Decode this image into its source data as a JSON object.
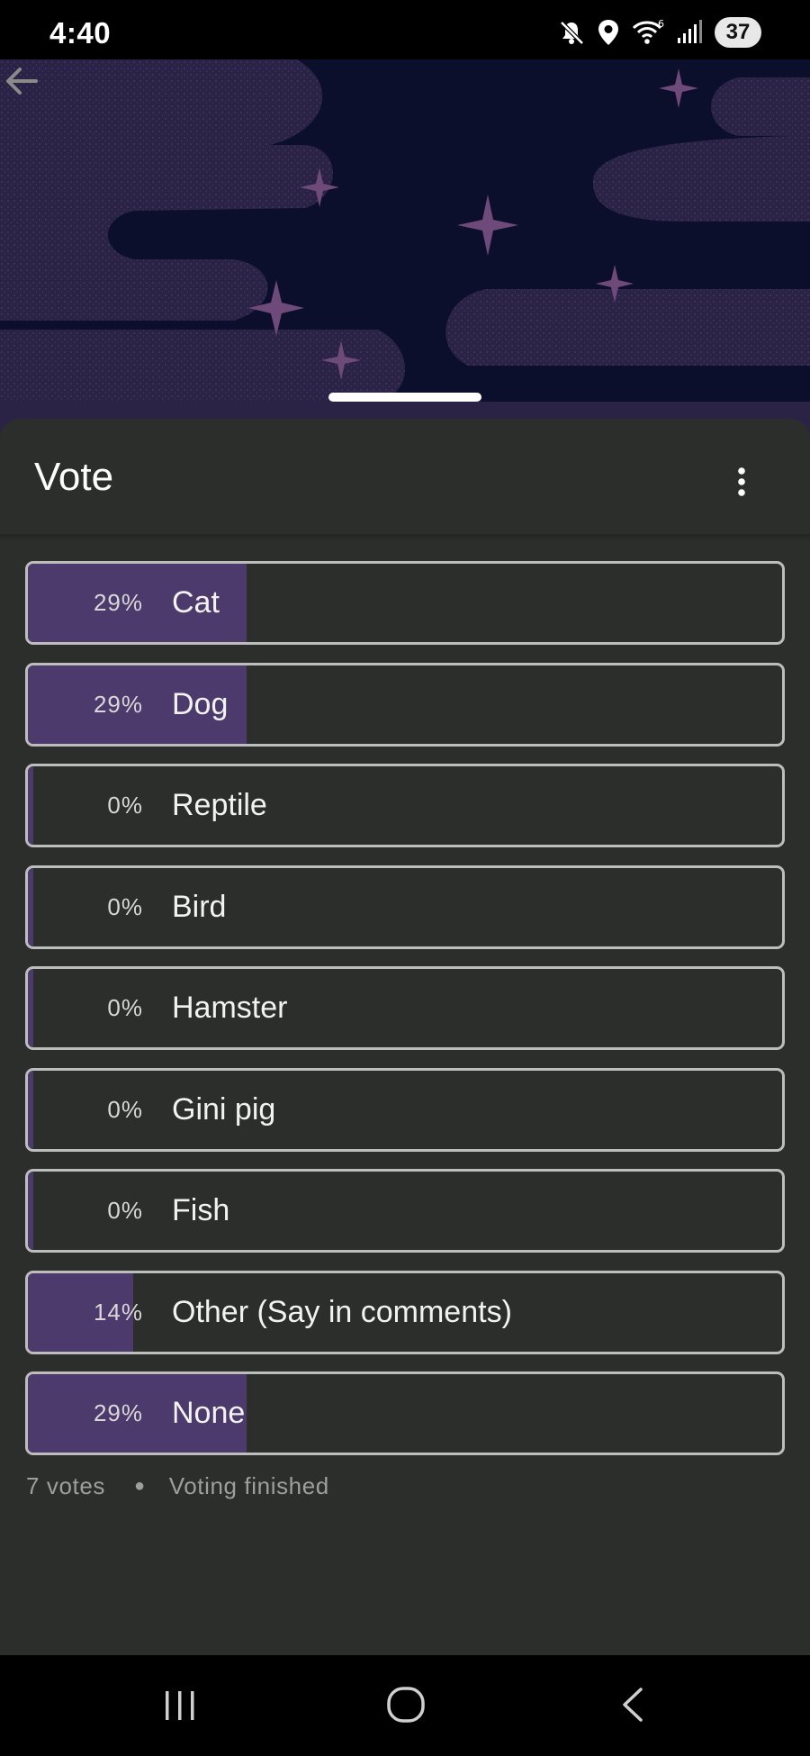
{
  "status_bar": {
    "time": "4:40",
    "battery": "37",
    "network": "6"
  },
  "poll": {
    "title": "Vote",
    "options": [
      {
        "percent": "29%",
        "label": "Cat",
        "value": 29
      },
      {
        "percent": "29%",
        "label": "Dog",
        "value": 29
      },
      {
        "percent": "0%",
        "label": "Reptile",
        "value": 0
      },
      {
        "percent": "0%",
        "label": "Bird",
        "value": 0
      },
      {
        "percent": "0%",
        "label": "Hamster",
        "value": 0
      },
      {
        "percent": "0%",
        "label": "Gini pig",
        "value": 0
      },
      {
        "percent": "0%",
        "label": "Fish",
        "value": 0
      },
      {
        "percent": "14%",
        "label": "Other (Say in comments)",
        "value": 14
      },
      {
        "percent": "29%",
        "label": "None",
        "value": 29
      }
    ],
    "votes": "7 votes",
    "status": "Voting finished"
  },
  "colors": {
    "fill": "#4b3a6b",
    "sheet": "#2b2e2b",
    "banner": "#0c0f2c"
  },
  "icons": [
    "mute-icon",
    "location-icon",
    "wifi-icon",
    "signal-icon",
    "back-arrow-icon",
    "more-vert-icon",
    "recent-apps-icon",
    "home-icon",
    "nav-back-icon"
  ]
}
